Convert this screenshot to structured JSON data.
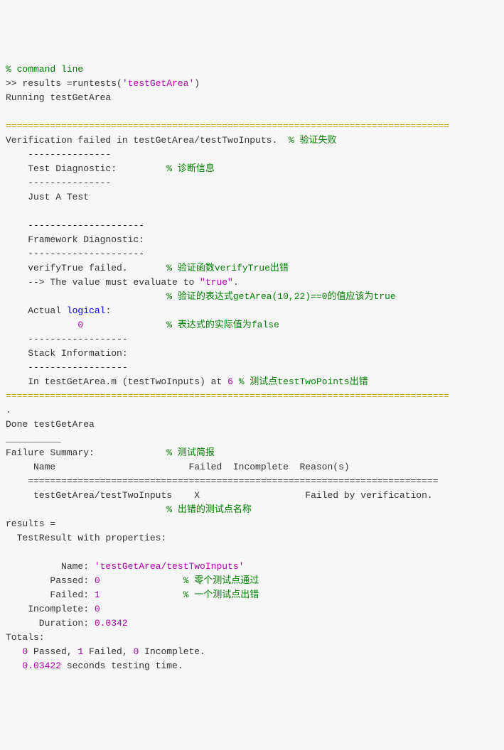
{
  "line01_comment": "% command line",
  "line02_prompt": ">> results =runtests(",
  "line02_str": "'testGetArea'",
  "line02_close": ")",
  "line03": "Running testGetArea",
  "div": "================================================================================",
  "line05a": "Verification failed in testGetArea/testTwoInputs.  ",
  "line05b": "% 验证失败",
  "line06": "    ---------------",
  "line07a": "    Test Diagnostic:         ",
  "line07b": "% 诊断信息",
  "line08": "    ---------------",
  "line09": "    Just A Test",
  "line11": "    ---------------------",
  "line12": "    Framework Diagnostic:",
  "line13": "    ---------------------",
  "line14a": "    verifyTrue failed.       ",
  "line14b": "% 验证函数verifyTrue出错",
  "line15a": "    --> The value must evaluate to ",
  "line15b": "\"true\"",
  "line15c": ".",
  "line16a": "                             ",
  "line16b": "% 验证的表达式getArea(10,22)==0的值应该为true",
  "line17a": "    Actual ",
  "line17b": "logical",
  "line17c": ":",
  "line18a": "             ",
  "line18b": "0",
  "line18c": "               ",
  "line18d": "% 表达式的实际值为false",
  "line19": "    ------------------",
  "line20": "    Stack Information:",
  "line21": "    ------------------",
  "line22a": "    In testGetArea.m (testTwoInputs) at ",
  "line22b": "6",
  "line22c": " ",
  "line22d": "% 测试点testTwoPoints出错",
  "line24": ".",
  "line25": "Done testGetArea",
  "line26": "__________",
  "line27a": "Failure Summary:",
  "line27b": "             ",
  "line27c": "% 测试简报",
  "line28a": "     Name                        Failed  Incomplete  Reason",
  "line28b": "(",
  "line28c": "s",
  "line28d": ")",
  "line29": "    ==========================================================================",
  "line30a": "     testGetArea/testTwoInputs    X                   Failed by verification",
  "line30b": ".",
  "line31a": "                             ",
  "line31b": "% 出错的测试点名称",
  "line32": "results =",
  "line33": "  TestResult with properties:",
  "line35a": "          Name: ",
  "line35b": "'testGetArea/testTwoInputs'",
  "line36a": "        Passed: ",
  "line36b": "0",
  "line36c": "               ",
  "line36d": "% 零个测试点通过",
  "line37a": "        Failed: ",
  "line37b": "1",
  "line37c": "               ",
  "line37d": "% 一个测试点出错",
  "line38a": "    Incomplete: ",
  "line38b": "0",
  "line39a": "      Duration: ",
  "line39b": "0.0342",
  "line40": "Totals:",
  "line41a": "   ",
  "line41b": "0",
  "line41c": " Passed, ",
  "line41d": "1",
  "line41e": " Failed, ",
  "line41f": "0",
  "line41g": " Incomplete.",
  "line42a": "   ",
  "line42b": "0.03422",
  "line42c": " seconds testing time."
}
